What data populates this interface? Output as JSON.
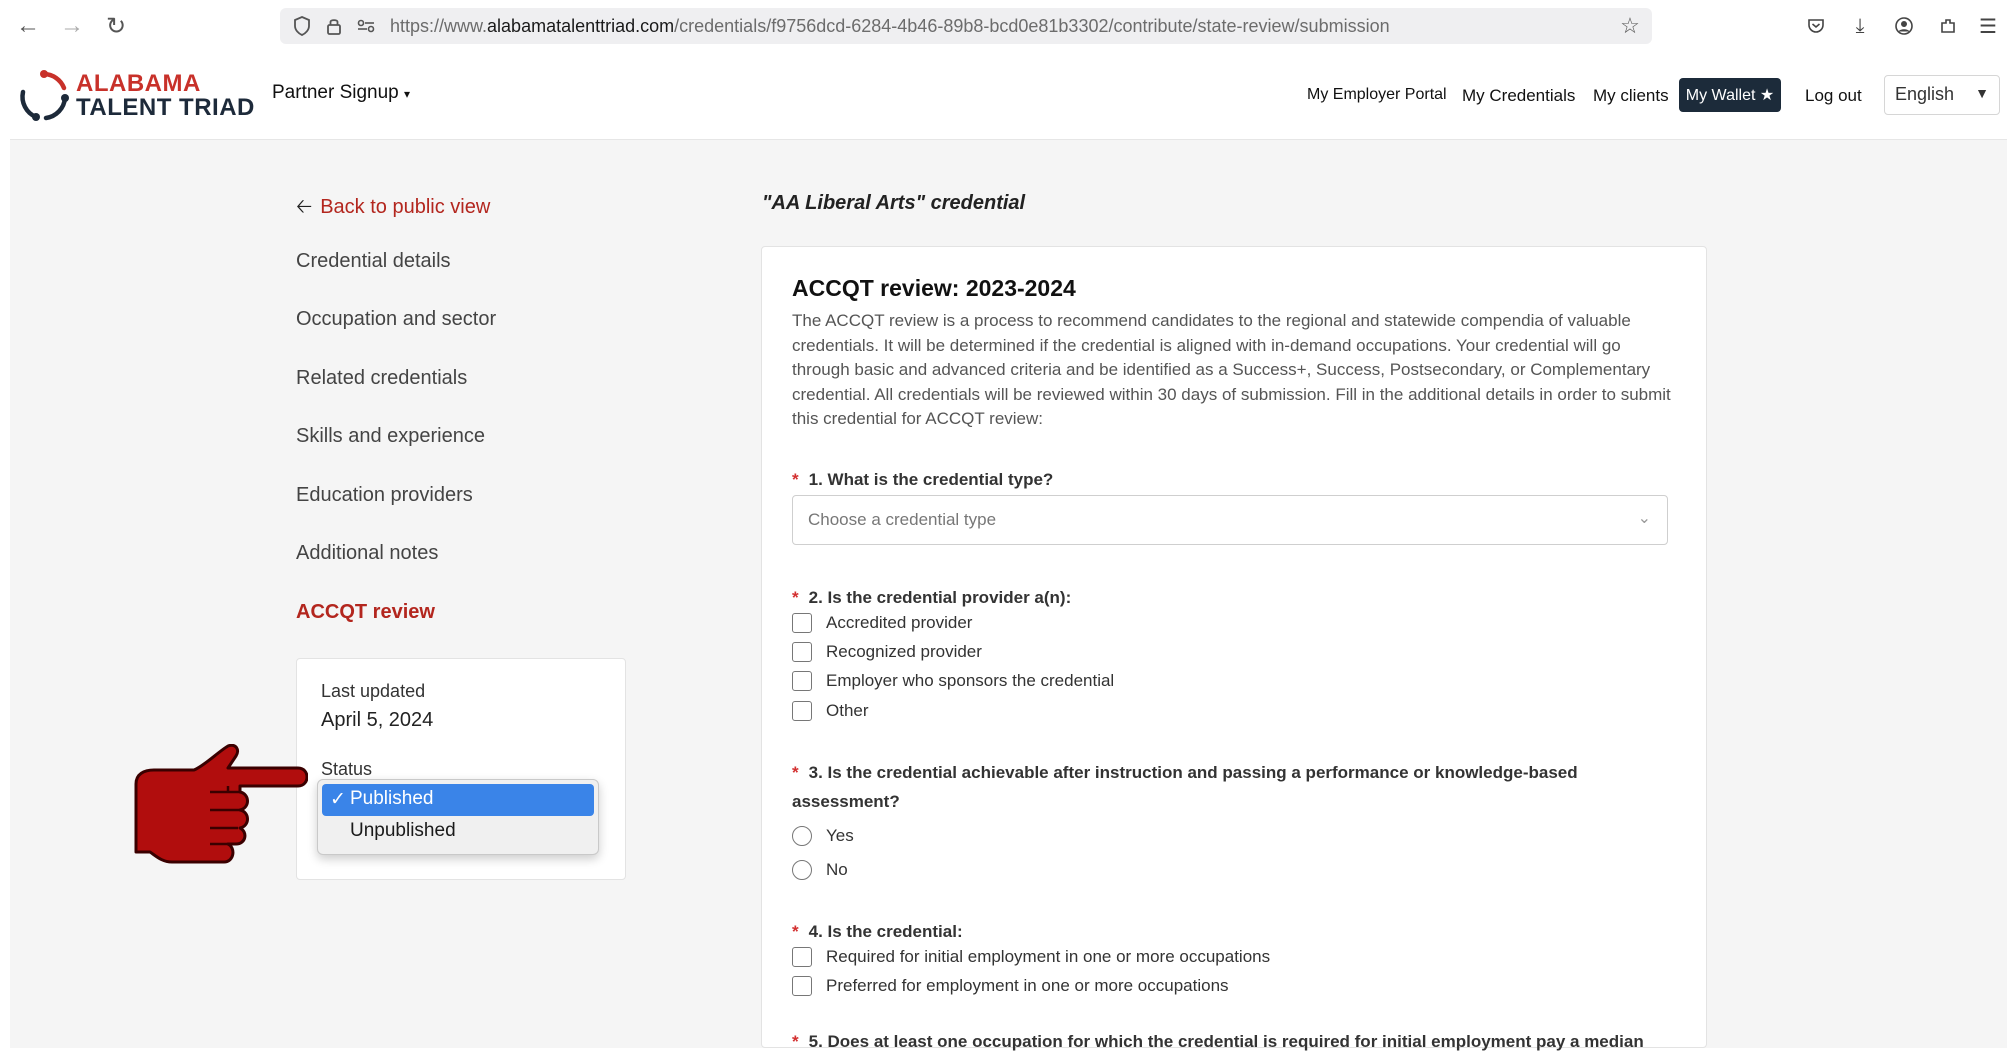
{
  "browser": {
    "url_prefix": "https://www.",
    "url_domain": "alabamatalenttriad.com",
    "url_path": "/credentials/f9756dcd-6284-4b46-89b8-bcd0e81b3302/contribute/state-review/submission"
  },
  "header": {
    "logo_line1": "ALABAMA",
    "logo_line2": "TALENT TRIAD",
    "partner_signup": "Partner Signup",
    "nav": {
      "employer_portal": "My Employer Portal",
      "credentials": "My Credentials",
      "clients": "My clients",
      "wallet": "My Wallet ★",
      "logout": "Log out"
    },
    "language": "English"
  },
  "sidebar": {
    "back_link": "Back to public view",
    "items": [
      {
        "label": "Credential details"
      },
      {
        "label": "Occupation and sector"
      },
      {
        "label": "Related credentials"
      },
      {
        "label": "Skills and experience"
      },
      {
        "label": "Education providers"
      },
      {
        "label": "Additional notes"
      },
      {
        "label": "ACCQT review"
      }
    ],
    "active_item": "ACCQT review",
    "status_card": {
      "last_updated_label": "Last updated",
      "last_updated_value": "April 5, 2024",
      "status_label": "Status",
      "options": [
        "Published",
        "Unpublished"
      ],
      "selected": "Published"
    }
  },
  "main": {
    "credential_title": "\"AA Liberal Arts\" credential",
    "heading": "ACCQT review: 2023-2024",
    "intro": "The ACCQT review is a process to recommend candidates to the regional and statewide compendia of valuable credentials. It will be determined if the credential is aligned with in-demand occupations. Your credential will go through basic and advanced criteria and be identified as a Success+, Success, Postsecondary, or Complementary credential. All credentials will be reviewed within 30 days of submission. Fill in the additional details in order to submit this credential for ACCQT review:",
    "q1": {
      "text": "1. What is the credential type?",
      "placeholder": "Choose a credential type"
    },
    "q2": {
      "text": "2. Is the credential provider a(n):",
      "options": [
        "Accredited provider",
        "Recognized provider",
        "Employer who sponsors the credential",
        "Other"
      ]
    },
    "q3": {
      "text": "3. Is the credential achievable after instruction and passing a performance or knowledge-based assessment?",
      "options": [
        "Yes",
        "No"
      ]
    },
    "q4": {
      "text": "4. Is the credential:",
      "options": [
        "Required for initial employment in one or more occupations",
        "Preferred for employment in one or more occupations"
      ]
    },
    "q5": {
      "text": "5. Does at least one occupation for which the credential is required for initial employment pay a median"
    }
  },
  "colors": {
    "brand_red": "#b3261e",
    "dark_navy": "#1c2b3a",
    "select_blue": "#3a84e8"
  }
}
